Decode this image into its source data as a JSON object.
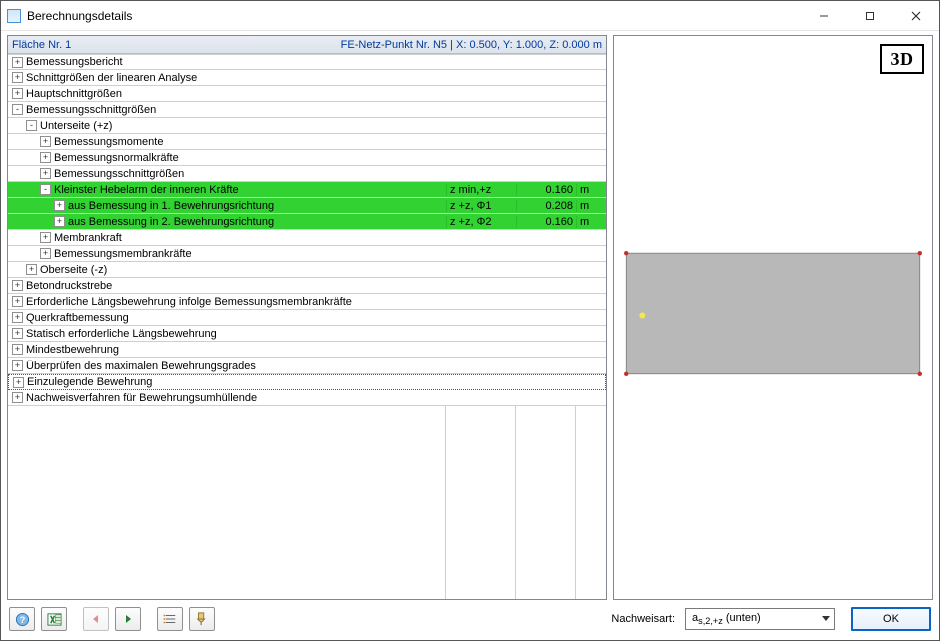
{
  "window": {
    "title": "Berechnungsdetails"
  },
  "header": {
    "left": "Fläche Nr. 1",
    "right_prefix": "FE-Netz-Punkt Nr. N5  |  X: ",
    "right_x": "0.500",
    "right_mid": ", Y: ",
    "right_y": "1.000",
    "right_mid2": ", Z: ",
    "right_z": "0.000",
    "right_unit": " m"
  },
  "tree": {
    "items": [
      {
        "toggle": "+",
        "indent": 0,
        "label": "Bemessungsbericht"
      },
      {
        "toggle": "+",
        "indent": 0,
        "label": "Schnittgrößen der linearen Analyse"
      },
      {
        "toggle": "+",
        "indent": 0,
        "label": "Hauptschnittgrößen"
      },
      {
        "toggle": "-",
        "indent": 0,
        "label": "Bemessungsschnittgrößen"
      },
      {
        "toggle": "-",
        "indent": 1,
        "label": "Unterseite (+z)"
      },
      {
        "toggle": "+",
        "indent": 2,
        "label": "Bemessungsmomente"
      },
      {
        "toggle": "+",
        "indent": 2,
        "label": "Bemessungsnormalkräfte"
      },
      {
        "toggle": "+",
        "indent": 2,
        "label": "Bemessungsschnittgrößen"
      },
      {
        "toggle": "-",
        "indent": 2,
        "label": "Kleinster Hebelarm der inneren Kräfte",
        "sym": "z min,+z",
        "value": "0.160",
        "unit": "m",
        "hl": true
      },
      {
        "toggle": "+",
        "indent": 3,
        "label": "aus Bemessung in 1. Bewehrungsrichtung",
        "sym": "z +z, Φ1",
        "value": "0.208",
        "unit": "m",
        "hl": true
      },
      {
        "toggle": "+",
        "indent": 3,
        "label": "aus Bemessung in 2. Bewehrungsrichtung",
        "sym": "z +z, Φ2",
        "value": "0.160",
        "unit": "m",
        "hl": true
      },
      {
        "toggle": "+",
        "indent": 2,
        "label": "Membrankraft"
      },
      {
        "toggle": "+",
        "indent": 2,
        "label": "Bemessungsmembrankräfte"
      },
      {
        "toggle": "+",
        "indent": 1,
        "label": "Oberseite (-z)"
      },
      {
        "toggle": "+",
        "indent": 0,
        "label": "Betondruckstrebe"
      },
      {
        "toggle": "+",
        "indent": 0,
        "label": "Erforderliche Längsbewehrung infolge Bemessungsmembrankräfte"
      },
      {
        "toggle": "+",
        "indent": 0,
        "label": "Querkraftbemessung"
      },
      {
        "toggle": "+",
        "indent": 0,
        "label": "Statisch erforderliche Längsbewehrung"
      },
      {
        "toggle": "+",
        "indent": 0,
        "label": "Mindestbewehrung"
      },
      {
        "toggle": "+",
        "indent": 0,
        "label": "Überprüfen des maximalen Bewehrungsgrades"
      },
      {
        "toggle": "+",
        "indent": 0,
        "label": "Einzulegende Bewehrung",
        "dotted": true
      },
      {
        "toggle": "+",
        "indent": 0,
        "label": "Nachweisverfahren für Bewehrungsumhüllende"
      }
    ]
  },
  "viewport": {
    "badge": "3D"
  },
  "footer": {
    "label": "Nachweisart:",
    "select_html": "a<sub>s,2,+z</sub> (unten)",
    "ok": "OK"
  }
}
